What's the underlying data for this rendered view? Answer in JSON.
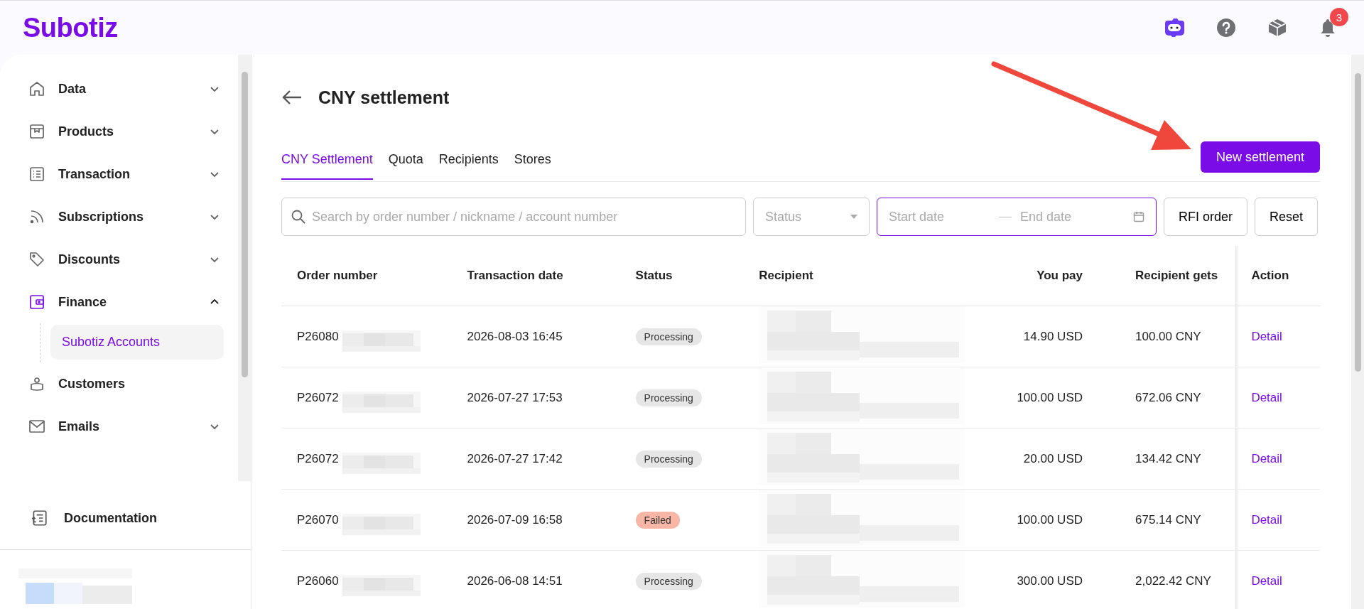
{
  "topbar": {
    "logo": "Subotiz",
    "notification_count": "3"
  },
  "sidebar": {
    "items": [
      {
        "label": "Data",
        "expandable": true,
        "expanded": false,
        "active": false
      },
      {
        "label": "Products",
        "expandable": true,
        "expanded": false,
        "active": false
      },
      {
        "label": "Transaction",
        "expandable": true,
        "expanded": false,
        "active": false
      },
      {
        "label": "Subscriptions",
        "expandable": true,
        "expanded": false,
        "active": false
      },
      {
        "label": "Discounts",
        "expandable": true,
        "expanded": false,
        "active": false
      },
      {
        "label": "Finance",
        "expandable": true,
        "expanded": true,
        "active": true,
        "children": [
          {
            "label": "Subotiz Accounts",
            "selected": true
          }
        ]
      },
      {
        "label": "Customers",
        "expandable": false,
        "active": false
      },
      {
        "label": "Emails",
        "expandable": true,
        "expanded": false,
        "active": false
      }
    ],
    "footer_link": "Documentation"
  },
  "page": {
    "title": "CNY settlement",
    "tabs": [
      {
        "label": "CNY Settlement",
        "selected": true
      },
      {
        "label": "Quota",
        "selected": false
      },
      {
        "label": "Recipients",
        "selected": false
      },
      {
        "label": "Stores",
        "selected": false
      }
    ],
    "primary_button": "New settlement",
    "filters": {
      "search_placeholder": "Search by order number / nickname / account number",
      "status_placeholder": "Status",
      "start_placeholder": "Start date",
      "end_placeholder": "End date",
      "buttons": [
        "RFI order",
        "Reset"
      ]
    },
    "table": {
      "columns": [
        "Order number",
        "Transaction date",
        "Status",
        "Recipient",
        "You pay",
        "Recipient gets",
        "Action"
      ],
      "rows": [
        {
          "order": "P26080",
          "date": "2026-08-03 16:45",
          "status": "Processing",
          "failed": false,
          "you_pay": "14.90 USD",
          "recipient_gets": "100.00 CNY",
          "action": "Detail"
        },
        {
          "order": "P26072",
          "date": "2026-07-27 17:53",
          "status": "Processing",
          "failed": false,
          "you_pay": "100.00 USD",
          "recipient_gets": "672.06 CNY",
          "action": "Detail"
        },
        {
          "order": "P26072",
          "date": "2026-07-27 17:42",
          "status": "Processing",
          "failed": false,
          "you_pay": "20.00 USD",
          "recipient_gets": "134.42 CNY",
          "action": "Detail"
        },
        {
          "order": "P26070",
          "date": "2026-07-09 16:58",
          "status": "Failed",
          "failed": true,
          "you_pay": "100.00 USD",
          "recipient_gets": "675.14 CNY",
          "action": "Detail"
        },
        {
          "order": "P26060",
          "date": "2026-06-08 14:51",
          "status": "Processing",
          "failed": false,
          "you_pay": "300.00 USD",
          "recipient_gets": "2,022.42 CNY",
          "action": "Detail"
        }
      ]
    }
  }
}
